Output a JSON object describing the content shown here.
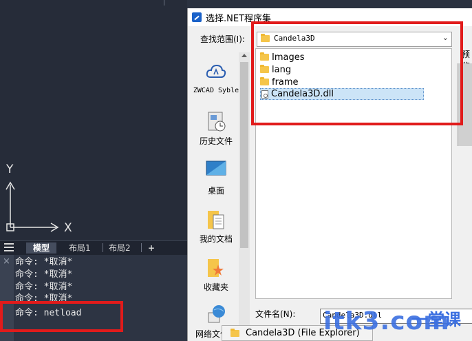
{
  "cad": {
    "axis_y": "Y",
    "axis_x": "X",
    "tabs": [
      {
        "label": "模型"
      },
      {
        "label": "布局1"
      },
      {
        "label": "布局2"
      },
      {
        "label": "+"
      }
    ],
    "command_close": "×",
    "command_lines": [
      "命令: *取消*",
      "命令: *取消*",
      "命令: *取消*",
      "命令: *取消*",
      "命令: netload"
    ]
  },
  "dialog": {
    "title": "选择.NET程序集",
    "lookin_label": "查找范围(I):",
    "lookin_value": "Candela3D",
    "preview_label": "预览",
    "places": [
      {
        "label": "ZWCAD Syble",
        "icon": "cloud-icon"
      },
      {
        "label": "历史文件",
        "icon": "history-icon"
      },
      {
        "label": "桌面",
        "icon": "desktop-icon"
      },
      {
        "label": "我的文档",
        "icon": "documents-icon"
      },
      {
        "label": "收藏夹",
        "icon": "favorites-icon"
      },
      {
        "label": "网络文件夹",
        "icon": "network-icon"
      }
    ],
    "files": [
      {
        "name": "Images",
        "type": "folder"
      },
      {
        "name": "lang",
        "type": "folder"
      },
      {
        "name": "frame",
        "type": "folder"
      },
      {
        "name": "Candela3D.dll",
        "type": "dll",
        "selected": true
      }
    ],
    "filename_label": "文件名(N):",
    "filename_value": "Candela3D.dll"
  },
  "taskbar_tooltip": "Candela3D (File Explorer)",
  "watermark": {
    "text": "itk3.com",
    "cn": "一堂课"
  },
  "colors": {
    "highlight_red": "#e11b1b",
    "selection_blue": "#cce4f7",
    "cad_bg": "#262c39"
  }
}
